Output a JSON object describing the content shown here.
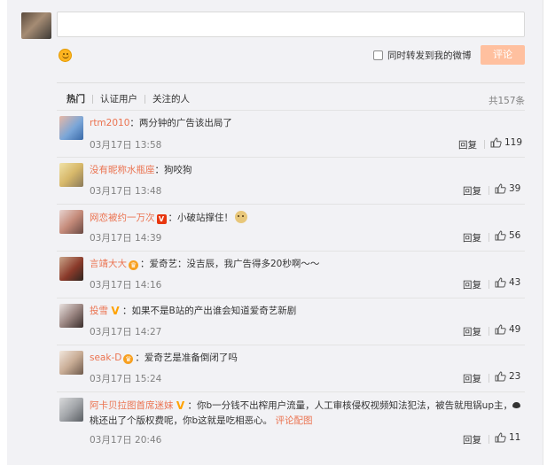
{
  "compose": {
    "value": "",
    "repost_label": "同时转发到我的微博",
    "submit_label": "评论"
  },
  "tabs": [
    {
      "label": "热门"
    },
    {
      "label": "认证用户"
    },
    {
      "label": "关注的人"
    }
  ],
  "total_count": "共157条",
  "reply_label": "回复",
  "comments": [
    {
      "user": "rtm2010",
      "text": "：两分钟的广告该出局了",
      "time": "03月17日 13:58",
      "likes": "119",
      "badge": "none"
    },
    {
      "user": "没有昵称水瓶座",
      "text": "：狗咬狗",
      "time": "03月17日 13:48",
      "likes": "39",
      "badge": "none"
    },
    {
      "user": "网恋被约一万次",
      "text": "：小破站撑住！",
      "time": "03月17日 14:39",
      "likes": "56",
      "badge": "v-red",
      "emoji": "doge"
    },
    {
      "user": "言靖大大",
      "text": "：爱奇艺：没吉辰，我广告得多20秒啊～～",
      "time": "03月17日 14:16",
      "likes": "43",
      "badge": "crown"
    },
    {
      "user": "投雪",
      "text": "：如果不是B站的产出谁会知道爱奇艺新剧",
      "time": "03月17日 14:27",
      "likes": "49",
      "badge": "v-gold"
    },
    {
      "user": "seak-D",
      "text": "：爱奇艺是准备倒闭了吗",
      "time": "03月17日 15:24",
      "likes": "23",
      "badge": "crown"
    },
    {
      "user": "阿卡贝拉图首席迷妹",
      "text_a": "：你b一分钱不出榨用户流量，人工审核侵权视频知法犯法，被告就甩锅up主，",
      "text_b": "桃还出了个版权费呢，你b这就是吃相恶心。",
      "link": "评论配图",
      "time": "03月17日 20:46",
      "likes": "11",
      "badge": "v-gold"
    }
  ],
  "colors": {
    "accent": "#eb7350",
    "submit_bg": "#ffc09f",
    "panel_bg": "#f2f2f5",
    "meta_gray": "#808080"
  }
}
